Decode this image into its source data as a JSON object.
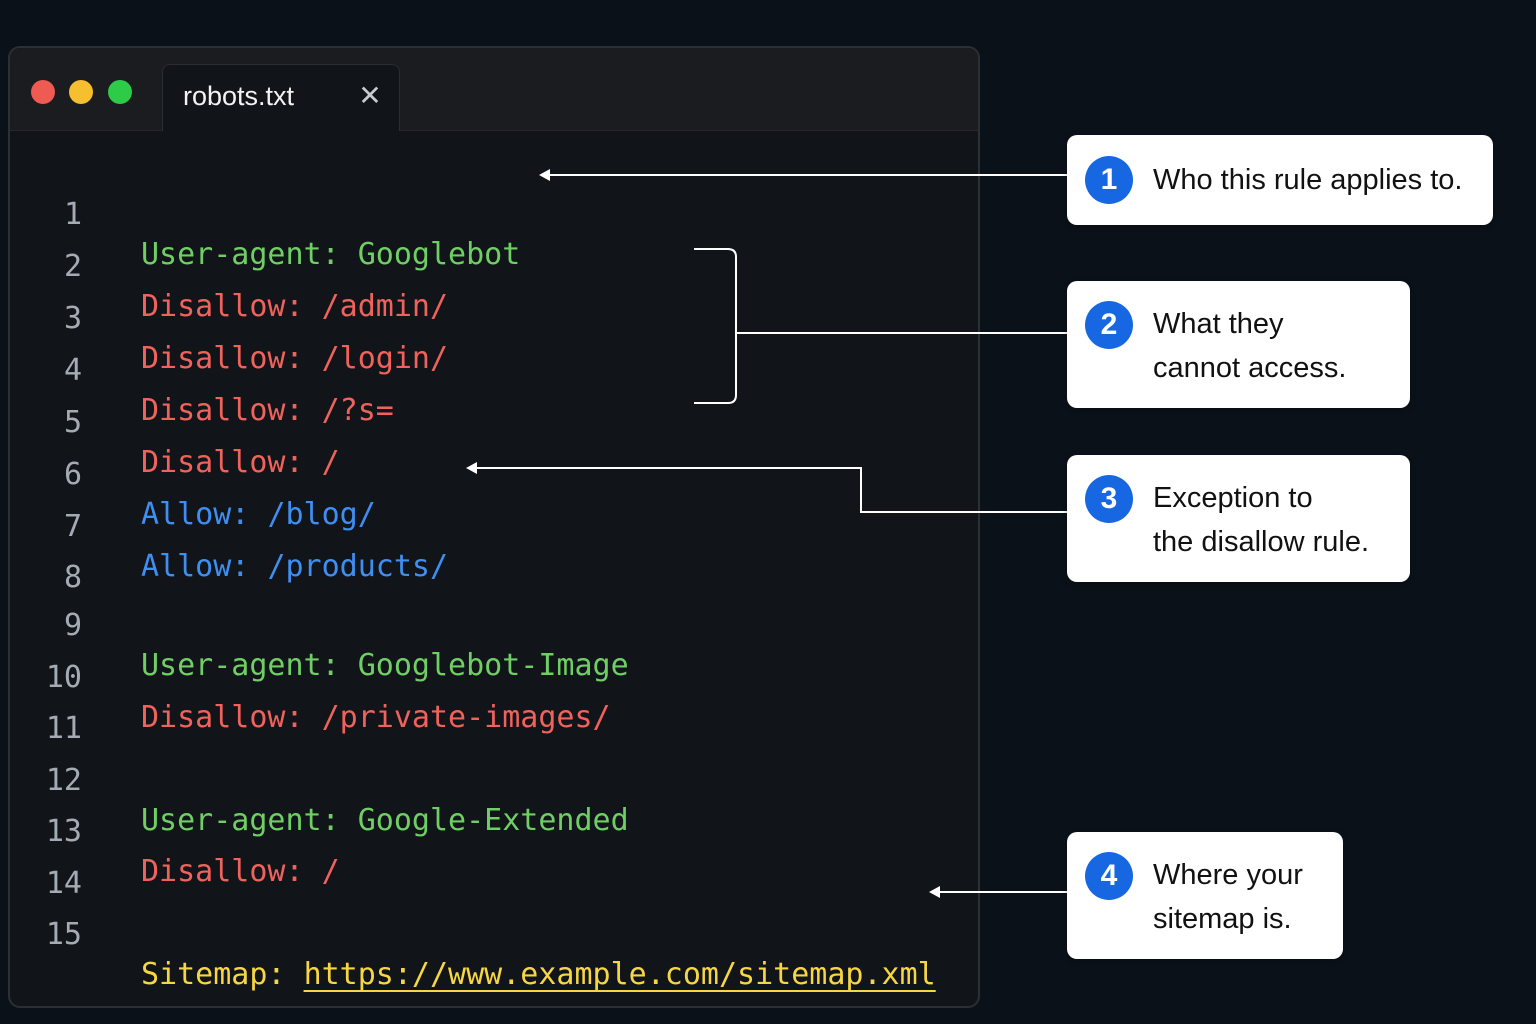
{
  "editor": {
    "tab_title": "robots.txt",
    "tab_close_glyph": "✕",
    "traffic_lights": {
      "close": "#ef5a52",
      "minimize": "#f6bf2f",
      "zoom": "#2ecb48"
    }
  },
  "colors": {
    "user_agent": "#6fcf64",
    "disallow": "#f0625c",
    "allow": "#3f8ff3",
    "sitemap": "#f6d743",
    "badge": "#1767e3"
  },
  "lines": [
    {
      "num": "1",
      "key": "User-agent:",
      "value": "Googlebot"
    },
    {
      "num": "2",
      "key": "Disallow:",
      "value": "/admin/"
    },
    {
      "num": "3",
      "key": "Disallow:",
      "value": "/login/"
    },
    {
      "num": "4",
      "key": "Disallow:",
      "value": "/?s="
    },
    {
      "num": "5",
      "key": "Disallow:",
      "value": "/"
    },
    {
      "num": "6",
      "key": "Allow:",
      "value": "/blog/"
    },
    {
      "num": "7",
      "key": "Allow:",
      "value": "/products/"
    },
    {
      "num": "8",
      "key": "",
      "value": ""
    },
    {
      "num": "9",
      "key": "User-agent:",
      "value": "Googlebot-Image"
    },
    {
      "num": "10",
      "key": "Disallow:",
      "value": "/private-images/"
    },
    {
      "num": "11",
      "key": "",
      "value": ""
    },
    {
      "num": "12",
      "key": "User-agent:",
      "value": "Google-Extended"
    },
    {
      "num": "13",
      "key": "Disallow:",
      "value": "/"
    },
    {
      "num": "14",
      "key": "",
      "value": ""
    },
    {
      "num": "15",
      "key": "Sitemap:",
      "value": "https://www.example.com/sitemap.xml"
    }
  ],
  "callouts": [
    {
      "number": "1",
      "line1": "Who this rule applies to.",
      "line2": ""
    },
    {
      "number": "2",
      "line1": "What they",
      "line2": "cannot access."
    },
    {
      "number": "3",
      "line1": "Exception to",
      "line2": "the disallow rule."
    },
    {
      "number": "4",
      "line1": "Where your",
      "line2": "sitemap is."
    }
  ]
}
